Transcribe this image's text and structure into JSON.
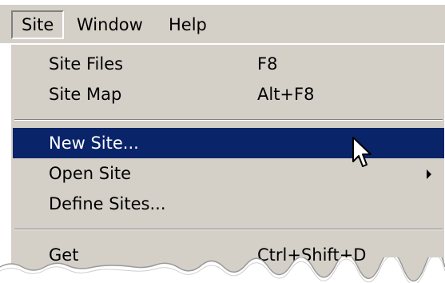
{
  "menubar": {
    "items": [
      {
        "label": "Site",
        "active": true
      },
      {
        "label": "Window",
        "active": false
      },
      {
        "label": "Help",
        "active": false
      }
    ]
  },
  "dropdown": {
    "groups": [
      [
        {
          "label": "Site Files",
          "shortcut": "F8"
        },
        {
          "label": "Site Map",
          "shortcut": "Alt+F8"
        }
      ],
      [
        {
          "label": "New Site...",
          "shortcut": "",
          "highlighted": true
        },
        {
          "label": "Open Site",
          "shortcut": "",
          "submenu": true
        },
        {
          "label": "Define Sites...",
          "shortcut": ""
        }
      ],
      [
        {
          "label": "Get",
          "shortcut": "Ctrl+Shift+D"
        }
      ]
    ]
  },
  "colors": {
    "menu_background": "#d4d0c8",
    "highlight_background": "#0a246a",
    "highlight_text": "#ffffff"
  },
  "icons": {
    "cursor": "mouse-pointer-icon",
    "submenu": "submenu-arrow-icon"
  }
}
